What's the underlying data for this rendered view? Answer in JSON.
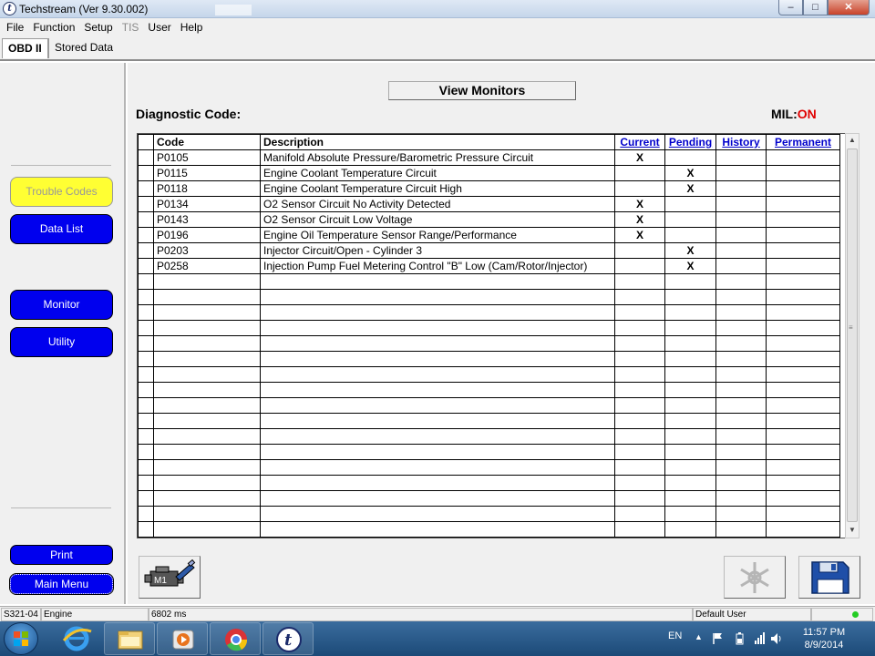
{
  "window": {
    "title": "Techstream (Ver 9.30.002)"
  },
  "menu": [
    "File",
    "Function",
    "Setup",
    "TIS",
    "User",
    "Help"
  ],
  "tabs": [
    "OBD II",
    "Stored Data"
  ],
  "sidebar": {
    "trouble_codes": "Trouble Codes",
    "data_list": "Data List",
    "monitor": "Monitor",
    "utility": "Utility",
    "print": "Print",
    "main_menu": "Main Menu"
  },
  "main": {
    "view_monitors": "View Monitors",
    "diagnostic_label": "Diagnostic Code:",
    "mil_label": "MIL:",
    "mil_value": "ON",
    "mil_color": "#e00000"
  },
  "table": {
    "headers": [
      "Code",
      "Description",
      "Current",
      "Pending",
      "History",
      "Permanent"
    ],
    "rows": [
      {
        "code": "P0105",
        "description": "Manifold Absolute Pressure/Barometric Pressure Circuit",
        "current": "X",
        "pending": "",
        "history": "",
        "permanent": ""
      },
      {
        "code": "P0115",
        "description": "Engine Coolant Temperature Circuit",
        "current": "",
        "pending": "X",
        "history": "",
        "permanent": ""
      },
      {
        "code": "P0118",
        "description": "Engine Coolant Temperature Circuit High",
        "current": "",
        "pending": "X",
        "history": "",
        "permanent": ""
      },
      {
        "code": "P0134",
        "description": "O2 Sensor Circuit No Activity Detected",
        "current": "X",
        "pending": "",
        "history": "",
        "permanent": ""
      },
      {
        "code": "P0143",
        "description": "O2 Sensor Circuit Low Voltage",
        "current": "X",
        "pending": "",
        "history": "",
        "permanent": ""
      },
      {
        "code": "P0196",
        "description": "Engine Oil Temperature Sensor Range/Performance",
        "current": "X",
        "pending": "",
        "history": "",
        "permanent": ""
      },
      {
        "code": "P0203",
        "description": "Injector Circuit/Open - Cylinder 3",
        "current": "",
        "pending": "X",
        "history": "",
        "permanent": ""
      },
      {
        "code": "P0258",
        "description": "Injection Pump Fuel Metering Control \"B\" Low (Cam/Rotor/Injector)",
        "current": "",
        "pending": "X",
        "history": "",
        "permanent": ""
      }
    ],
    "empty_rows": 17
  },
  "bottom_icons": {
    "left": "M1",
    "left_icon": "engine-check-icon",
    "mid_icon": "snowflake-icon",
    "right_icon": "save-icon"
  },
  "status": {
    "ecu": "S321-04",
    "system": "Engine",
    "time": "6802 ms",
    "user": "Default User",
    "led_color": "#22cc22"
  },
  "taskbar": {
    "apps": [
      "internet-explorer-icon",
      "file-explorer-icon",
      "media-player-icon",
      "chrome-icon",
      "techstream-icon"
    ],
    "lang": "EN",
    "time": "11:57 PM",
    "date": "8/9/2014"
  }
}
